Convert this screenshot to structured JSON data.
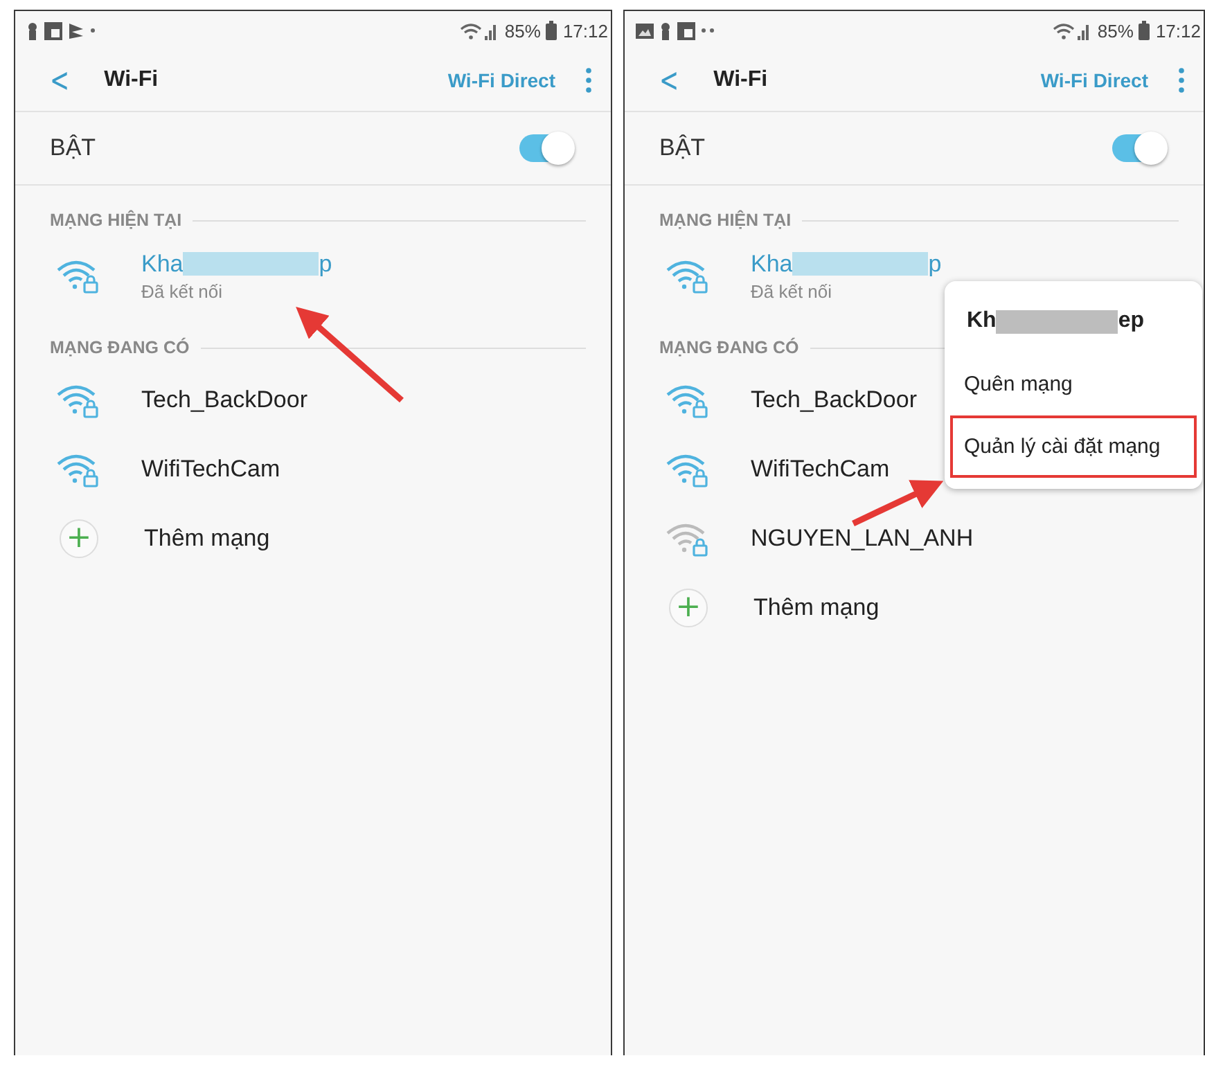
{
  "phones": [
    {
      "status_bar": {
        "notification_icons": [
          {
            "kind": "person"
          },
          {
            "kind": "square"
          },
          {
            "kind": "flag"
          },
          {
            "kind": "dot"
          }
        ],
        "battery": "85%",
        "time": "17:12"
      },
      "toolbar": {
        "back": "<",
        "title": "Wi-Fi",
        "action": "Wi-Fi Direct"
      },
      "master_switch": {
        "label": "BẬT",
        "on": true
      },
      "current_section": "MẠNG HIỆN TẠI",
      "current_network": {
        "name_start": "Kha",
        "name_end": "p",
        "redacted": true,
        "status": "Đã kết nối"
      },
      "available_section": "MẠNG ĐANG CÓ",
      "networks": [
        {
          "name": "Tech_BackDoor",
          "weak": false
        },
        {
          "name": "WifiTechCam",
          "weak": false
        }
      ],
      "add_network": {
        "icon": "+",
        "label": "Thêm mạng"
      },
      "arrow": {
        "kind": "up-left"
      }
    },
    {
      "status_bar": {
        "notification_icons": [
          {
            "kind": "image"
          },
          {
            "kind": "person"
          },
          {
            "kind": "square"
          },
          {
            "kind": "dots"
          }
        ],
        "battery": "85%",
        "time": "17:12"
      },
      "toolbar": {
        "back": "<",
        "title": "Wi-Fi",
        "action": "Wi-Fi Direct"
      },
      "master_switch": {
        "label": "BẬT",
        "on": true
      },
      "current_section": "MẠNG HIỆN TẠI",
      "current_network": {
        "name_start": "Kha",
        "name_end": "p",
        "redacted": true,
        "status": "Đã kết nối"
      },
      "available_section": "MẠNG ĐANG CÓ",
      "networks": [
        {
          "name": "Tech_BackDoor",
          "weak": false
        },
        {
          "name": "WifiTechCam",
          "weak": false
        },
        {
          "name": "NGUYEN_LAN_ANH",
          "weak": true
        }
      ],
      "add_network": {
        "icon": "+",
        "label": "Thêm mạng"
      },
      "popup_menu": {
        "title_start": "Kh",
        "title_end": "ep",
        "items": [
          {
            "label": "Quên mạng",
            "highlighted": false
          },
          {
            "label": "Quản lý cài đặt mạng",
            "highlighted": true
          }
        ]
      },
      "arrow": {
        "kind": "right"
      }
    }
  ]
}
